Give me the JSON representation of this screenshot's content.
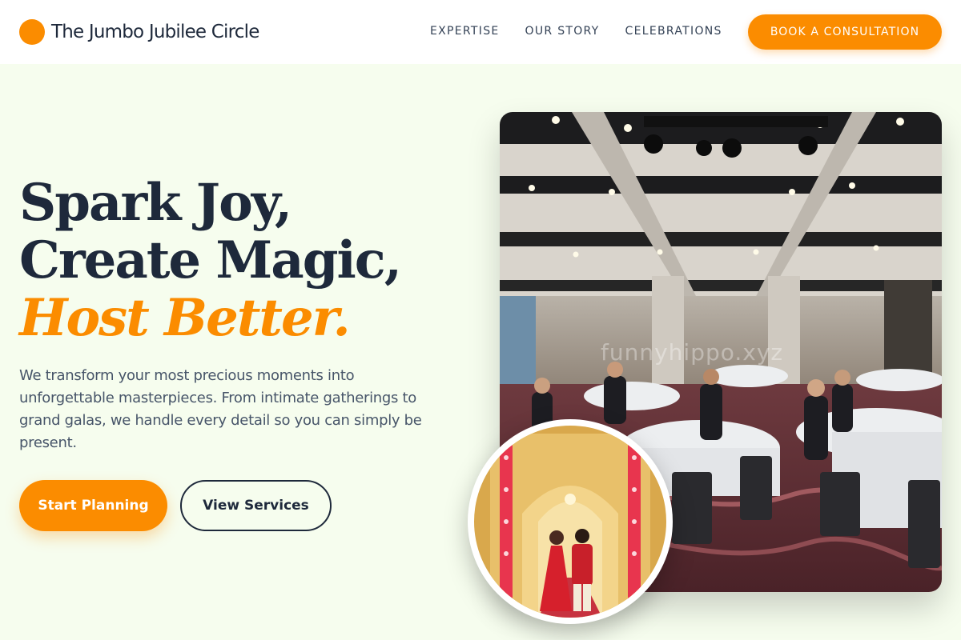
{
  "brand": {
    "name": "The Jumbo Jubilee Circle",
    "accent_color": "#fb8c00",
    "dark_color": "#1e293b",
    "background_color": "#f6fdee"
  },
  "nav": {
    "items": [
      {
        "label": "EXPERTISE"
      },
      {
        "label": "OUR STORY"
      },
      {
        "label": "CELEBRATIONS"
      }
    ],
    "cta_label": "BOOK A CONSULTATION"
  },
  "hero": {
    "headline_line1": "Spark Joy,",
    "headline_line2": "Create Magic,",
    "headline_accent": "Host Better.",
    "description": "We transform your most precious moments into unforgettable masterpieces. From intimate gatherings to grand galas, we handle every detail so you can simply be present.",
    "primary_button": "Start Planning",
    "secondary_button": "View Services"
  },
  "images": {
    "main_photo_watermark": "funnyhippo.xyz",
    "main_photo_subject": "banquet-hall",
    "circle_photo_subject": "wedding-couple"
  }
}
